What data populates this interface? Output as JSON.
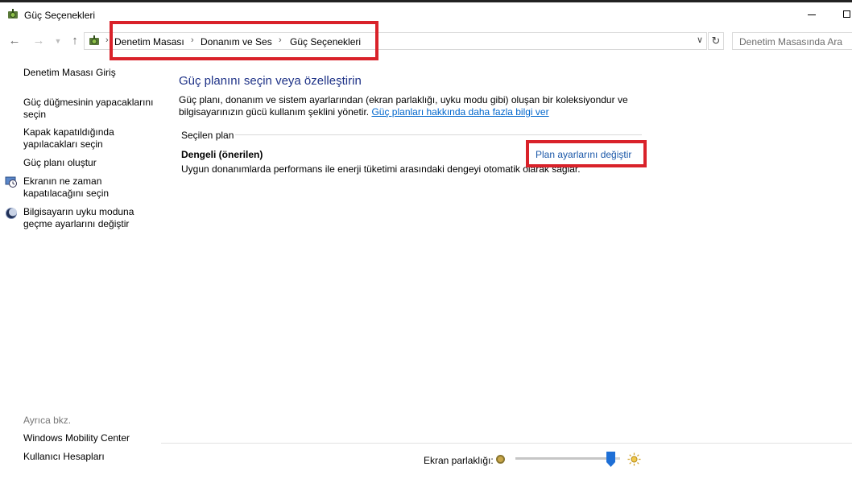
{
  "window": {
    "title": "Güç Seçenekleri",
    "app_icon": "power-options-icon"
  },
  "nav": {
    "back_icon": "back-arrow-icon",
    "forward_icon": "forward-arrow-icon",
    "recent_icon": "chevron-down-icon",
    "up_icon": "up-arrow-icon",
    "breadcrumb": [
      "Denetim Masası",
      "Donanım ve Ses",
      "Güç Seçenekleri"
    ],
    "search_placeholder": "Denetim Masasında Ara"
  },
  "sidebar": {
    "home_link": "Denetim Masası Giriş",
    "items": [
      {
        "label_lines": [
          "Güç düğmesinin yapacaklarını",
          "seçin"
        ],
        "icon": ""
      },
      {
        "label_lines": [
          "Kapak kapatıldığında",
          "yapılacakları seçin"
        ],
        "icon": ""
      },
      {
        "label_lines": [
          "Güç planı oluştur"
        ],
        "icon": ""
      },
      {
        "label_lines": [
          "Ekranın ne zaman",
          "kapatılacağını seçin"
        ],
        "icon": "display-clock-icon"
      },
      {
        "label_lines": [
          "Bilgisayarın uyku moduna",
          "geçme ayarlarını değiştir"
        ],
        "icon": "moon-icon"
      }
    ],
    "see_also_title": "Ayrıca bkz.",
    "see_also": [
      "Windows Mobility Center",
      "Kullanıcı Hesapları"
    ]
  },
  "main": {
    "heading": "Güç planını seçin veya özelleştirin",
    "description_line1": "Güç planı, donanım ve sistem ayarlarından (ekran parlaklığı, uyku modu gibi) oluşan bir koleksiyondur ve",
    "description_line2": "bilgisayarınızın gücü kullanım şeklini yönetir.",
    "description_link": "Güç planları hakkında daha fazla bilgi ver",
    "selected_plan_label": "Seçilen plan",
    "plan_name": "Dengeli (önerilen)",
    "plan_description": "Uygun donanımlarda performans ile enerji tüketimi arasındaki dengeyi otomatik olarak sağlar.",
    "change_plan_link": "Plan ayarlarını değiştir"
  },
  "brightness": {
    "label": "Ekran parlaklığı:",
    "value_fraction": 0.95
  },
  "highlight_color": "#d9222a"
}
